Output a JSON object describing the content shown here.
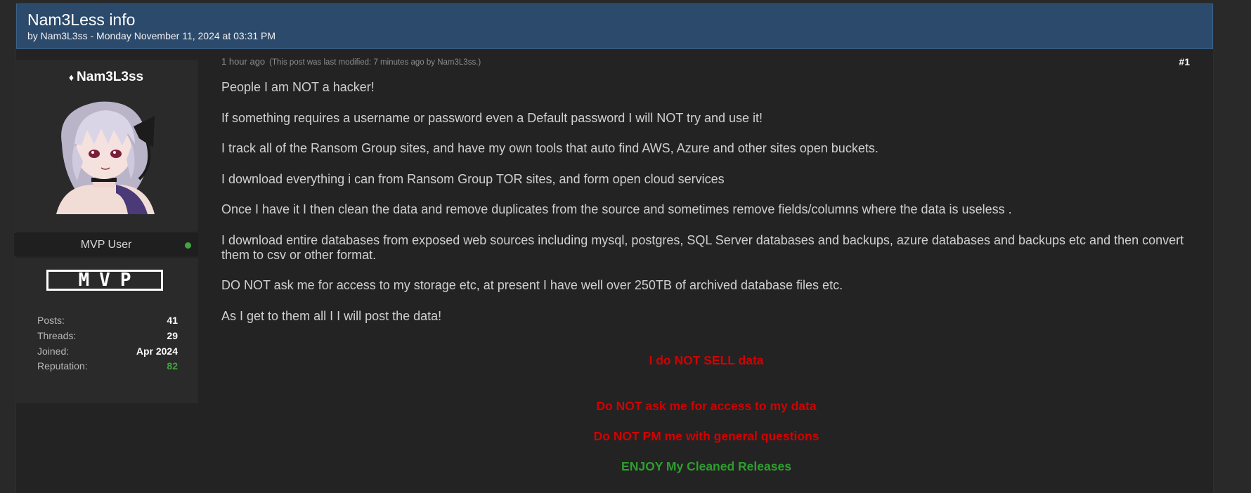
{
  "thread": {
    "title": "Nam3Less info",
    "meta": "by Nam3L3ss - Monday November 11, 2024 at 03:31 PM"
  },
  "author": {
    "gem_icon": "diamond-icon",
    "username": "Nam3L3ss",
    "role": "MVP User",
    "badge": "MVP",
    "stats": [
      {
        "label": "Posts:",
        "value": "41"
      },
      {
        "label": "Threads:",
        "value": "29"
      },
      {
        "label": "Joined:",
        "value": "Apr 2024"
      },
      {
        "label": "Reputation:",
        "value": "82"
      }
    ],
    "colors": {
      "online": "#3fa63f",
      "reputation": "#3fa63f"
    }
  },
  "post": {
    "time": "1 hour ago",
    "modified": "(This post was last modified: 7 minutes ago by Nam3L3ss.)",
    "number": "#1",
    "paragraphs": [
      "People I am NOT a hacker!",
      "If something requires a username or password even a Default password I will NOT try and use it!",
      "I track all of the Ransom Group sites, and have my own tools that auto find AWS, Azure and other sites open buckets.",
      "I download everything i can from Ransom Group TOR sites, and form open cloud services",
      "Once I have it I then clean the data and remove duplicates from the source and sometimes remove fields/columns where the data is useless .",
      "I download entire databases from exposed web sources including mysql, postgres, SQL Server databases and backups, azure databases and backups etc and then convert them to csv or other format.",
      "DO NOT ask me for access to my storage etc, at present I have well over 250TB of archived database files etc.",
      "As I get to them all I I will post the data!"
    ],
    "notices": [
      {
        "text": "I do NOT SELL data",
        "color": "#d40000"
      },
      {
        "text": "Do NOT ask me for access to my data",
        "color": "#d40000"
      },
      {
        "text": "Do NOT PM me with general questions",
        "color": "#d40000"
      },
      {
        "text": "ENJOY My Cleaned Releases",
        "color": "#2e9e2e"
      }
    ]
  },
  "colors": {
    "header_bg": "#2c4a6b",
    "page_bg": "#292929",
    "panel_bg": "#2a2a2a"
  }
}
